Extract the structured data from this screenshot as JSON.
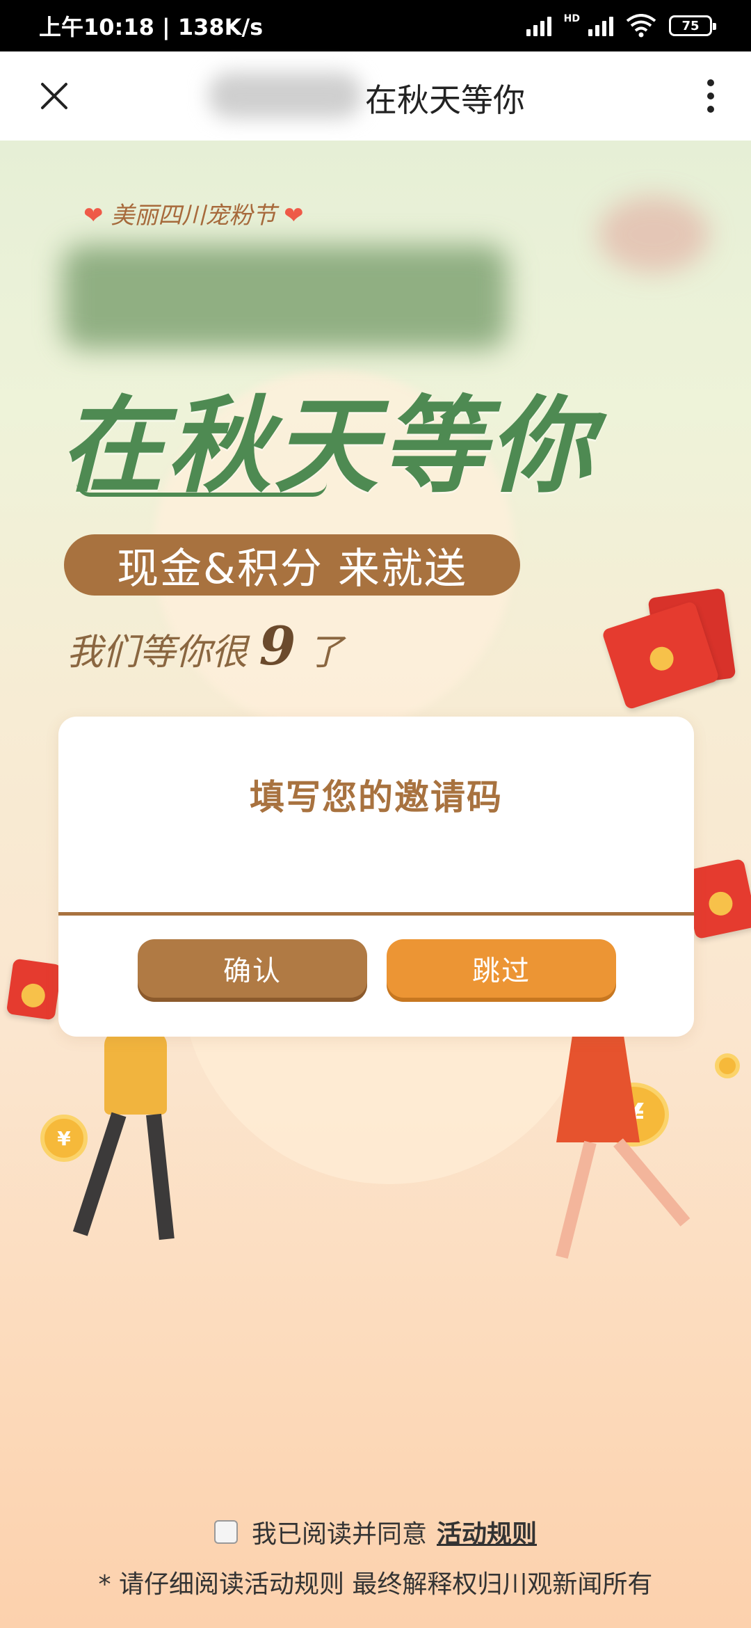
{
  "status_bar": {
    "time": "上午10:18",
    "speed": "138K/s",
    "hd": "HD",
    "battery": "75"
  },
  "header": {
    "title": "在秋天等你",
    "icons": [
      "close-icon",
      "more-icon"
    ]
  },
  "banner": {
    "festival": "美丽四川宠粉节",
    "hero_title": "在秋天等你",
    "pill_text": "现金&积分 来就送",
    "wait_prefix": "我们等你很",
    "wait_number": "9",
    "wait_suffix": "了"
  },
  "invite": {
    "title": "填写您的邀请码",
    "input_value": "",
    "input_placeholder": "",
    "confirm_label": "确认",
    "skip_label": "跳过"
  },
  "footer": {
    "agree_text": "我已阅读并同意",
    "rules_link": "活动规则",
    "disclaimer": "* 请仔细阅读活动规则 最终解释权归川观新闻所有"
  },
  "colors": {
    "accent": "#a8723f",
    "skip": "#ec9534",
    "title_green": "#4e8a52"
  }
}
